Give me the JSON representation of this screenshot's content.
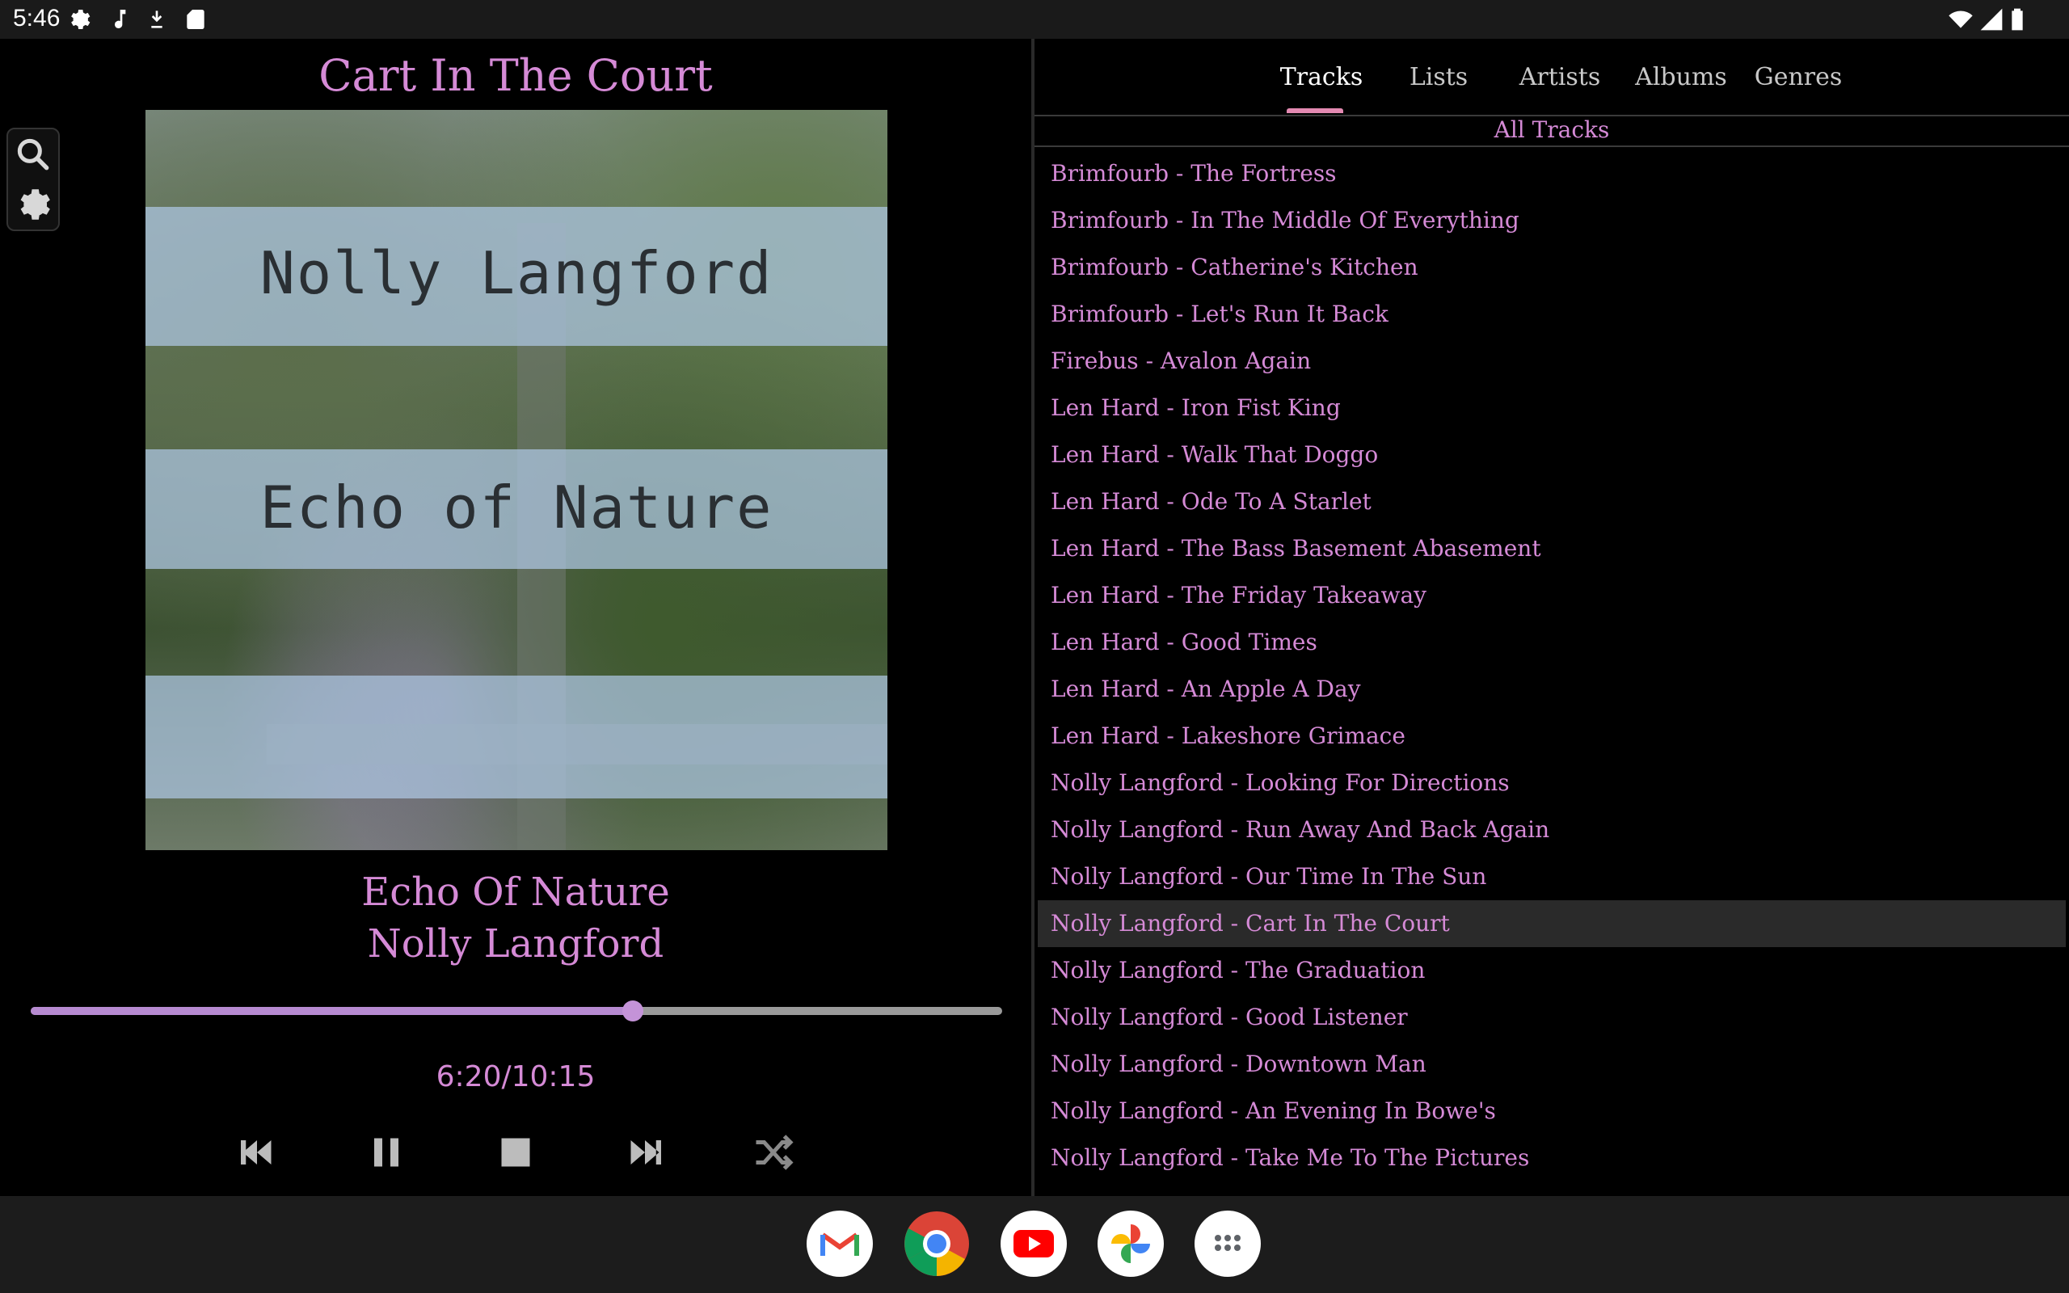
{
  "status": {
    "time": "5:46",
    "icons": [
      "gear-icon",
      "music-note-icon",
      "download-icon",
      "sd-card-icon",
      "wifi-icon",
      "signal-icon",
      "battery-icon"
    ]
  },
  "now_playing": {
    "title": "Cart In The Court",
    "album": "Echo Of Nature",
    "artist": "Nolly Langford",
    "progress_fraction": 0.62,
    "time_display": "6:20/10:15",
    "cover_art": {
      "line1": "Nolly Langford",
      "line2": "Echo of Nature"
    },
    "toolbar": [
      "search-icon",
      "settings-icon"
    ],
    "controls": [
      "previous-track-icon",
      "pause-icon",
      "stop-icon",
      "next-track-icon",
      "shuffle-icon"
    ]
  },
  "library": {
    "tabs": [
      {
        "label": "Tracks",
        "active": true
      },
      {
        "label": "Lists",
        "active": false
      },
      {
        "label": "Artists",
        "active": false
      },
      {
        "label": "Albums",
        "active": false
      },
      {
        "label": "Genres",
        "active": false
      }
    ],
    "list_header": "All Tracks",
    "tracks": [
      "Brimfourb - The Fortress",
      "Brimfourb - In The Middle Of Everything",
      "Brimfourb - Catherine's Kitchen",
      "Brimfourb - Let's Run It Back",
      "Firebus - Avalon Again",
      "Len Hard - Iron Fist King",
      "Len Hard - Walk That Doggo",
      "Len Hard - Ode To A Starlet",
      "Len Hard - The Bass Basement Abasement",
      "Len Hard - The Friday Takeaway",
      "Len Hard - Good Times",
      "Len Hard - An Apple A Day",
      "Len Hard - Lakeshore Grimace",
      "Nolly Langford - Looking For Directions",
      "Nolly Langford - Run Away And Back Again",
      "Nolly Langford - Our Time In The Sun",
      "Nolly Langford - Cart In The Court",
      "Nolly Langford - The Graduation",
      "Nolly Langford - Good Listener",
      "Nolly Langford - Downtown Man",
      "Nolly Langford - An Evening In Bowe's",
      "Nolly Langford - Take Me To The Pictures"
    ],
    "selected_index": 16
  },
  "dock": [
    "gmail-icon",
    "chrome-icon",
    "youtube-icon",
    "photos-icon",
    "app-drawer-icon"
  ],
  "colors": {
    "accent": "#d58ad6",
    "progress": "#b68ad0",
    "tab_indicator": "#e48ab2",
    "background": "#000000",
    "selected_row": "#2a2a2a"
  }
}
